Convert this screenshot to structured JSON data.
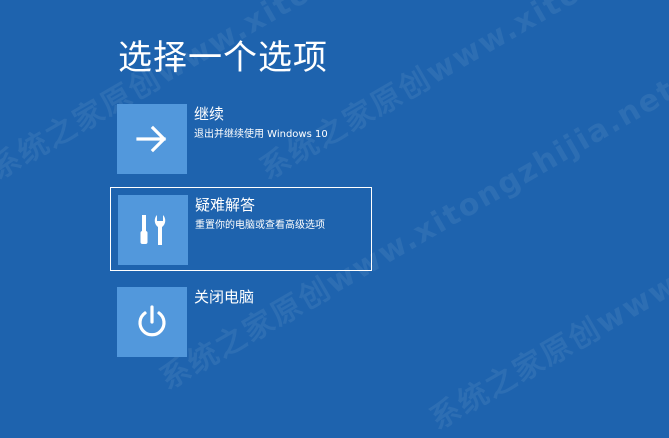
{
  "page": {
    "title": "选择一个选项",
    "watermark": "系统之家原创www.xitongzhijia.net"
  },
  "options": [
    {
      "title": "继续",
      "description": "退出并继续使用 Windows 10",
      "icon": "arrow-right-icon"
    },
    {
      "title": "疑难解答",
      "description": "重置你的电脑或查看高级选项",
      "icon": "tools-icon",
      "selected": true
    },
    {
      "title": "关闭电脑",
      "description": "",
      "icon": "power-icon"
    }
  ],
  "colors": {
    "background": "#1e63ae",
    "tile": "#5298dc",
    "text": "#ffffff"
  }
}
